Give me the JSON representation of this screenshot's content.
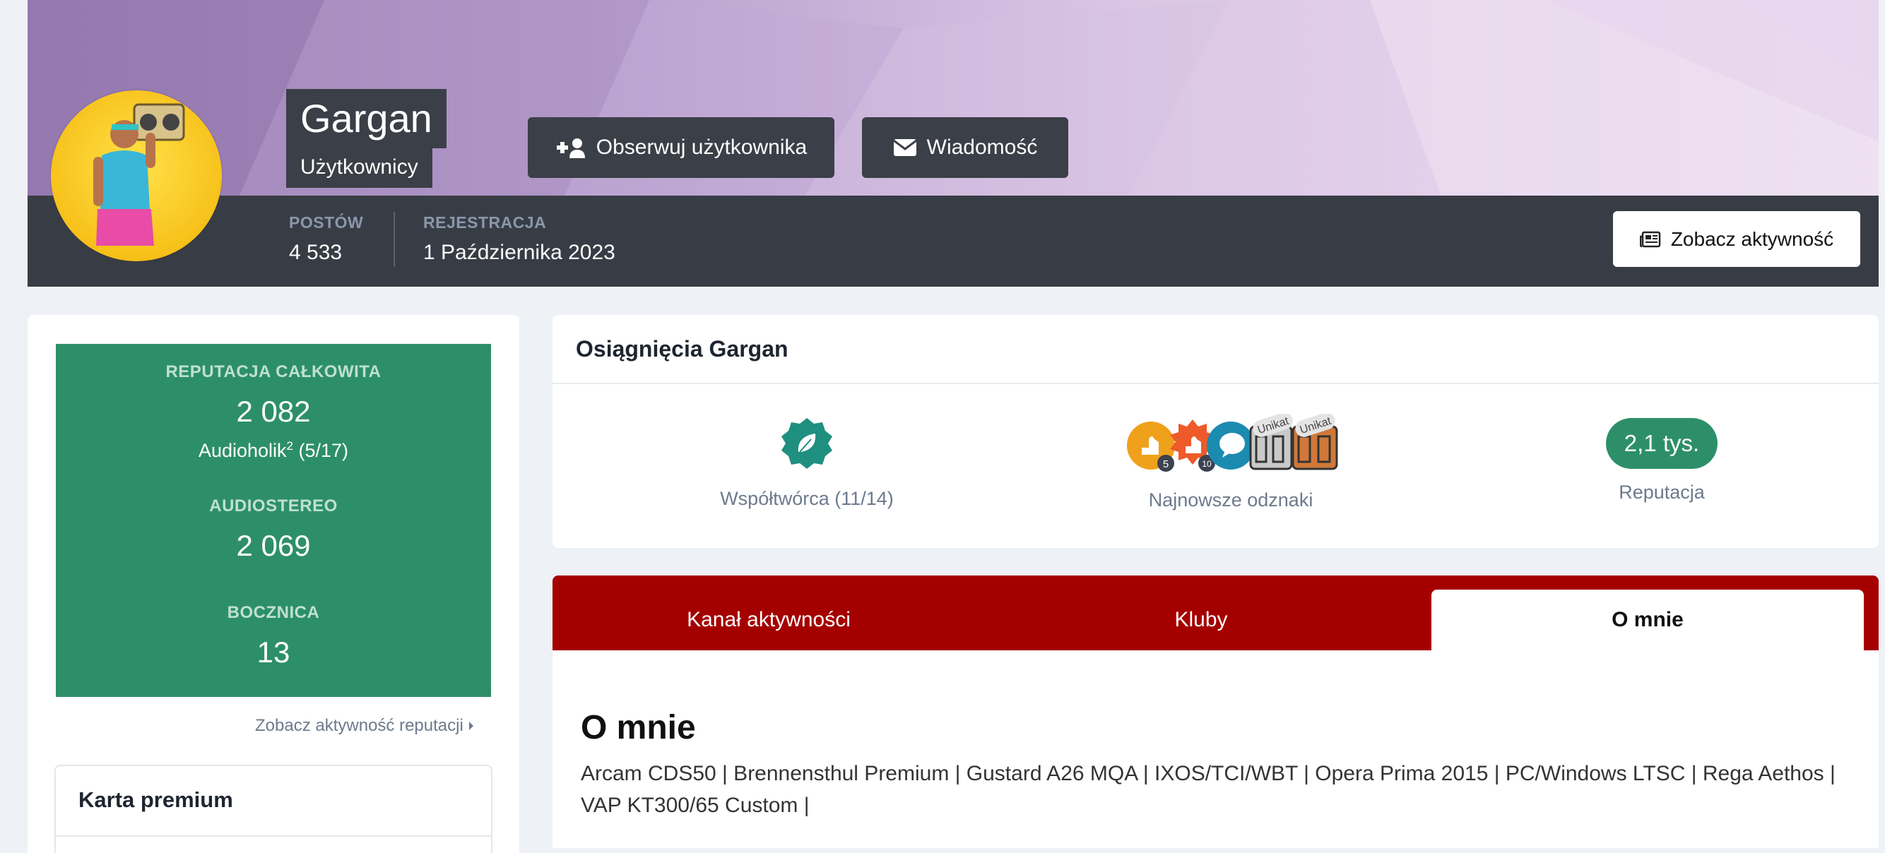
{
  "profile": {
    "name": "Gargan",
    "group": "Użytkownicy",
    "follow_label": "Obserwuj użytkownika",
    "message_label": "Wiadomość",
    "activity_label": "Zobacz aktywność"
  },
  "stats": {
    "posts_label": "POSTÓW",
    "posts_value": "4 533",
    "registration_label": "REJESTRACJA",
    "registration_value": "1 Października 2023"
  },
  "reputation": {
    "total_label": "REPUTACJA CAŁKOWITA",
    "total_value": "2 082",
    "rank_prefix": "Audioholik",
    "rank_sup": "2",
    "rank_suffix": " (5/17)",
    "audiostereo_label": "AUDIOSTEREO",
    "audiostereo_value": "2 069",
    "bocznica_label": "BOCZNICA",
    "bocznica_value": "13",
    "link_label": "Zobacz aktywność reputacji"
  },
  "premium": {
    "title": "Karta premium"
  },
  "achievements": {
    "title": "Osiągnięcia Gargan",
    "contributor_label": "Współtwórca (11/14)",
    "badges_label": "Najnowsze odznaki",
    "badge_count_5": "5",
    "badge_count_10": "10",
    "unique_label_1": "Unikat",
    "unique_label_2": "Unikat",
    "reputation_pill": "2,1 tys.",
    "reputation_label": "Reputacja"
  },
  "tabs": [
    {
      "label": "Kanał aktywności"
    },
    {
      "label": "Kluby"
    },
    {
      "label": "O mnie"
    }
  ],
  "about": {
    "title": "O mnie",
    "text": "Arcam CDS50 | Brennensthul Premium | Gustard A26 MQA | IXOS/TCI/WBT | Opera Prima 2015 | PC/Windows LTSC | Rega Aethos | VAP KT300/65 Custom |"
  },
  "colors": {
    "accent_green": "#2d8f69",
    "tab_red": "#a50000",
    "dark_bar": "#383d45"
  }
}
